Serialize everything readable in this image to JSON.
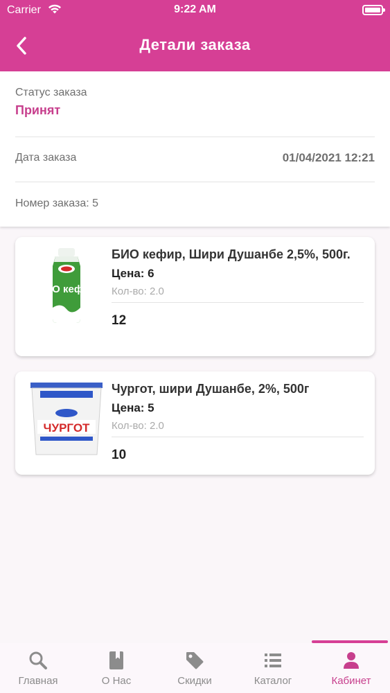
{
  "status_bar": {
    "carrier": "Carrier",
    "time": "9:22 AM"
  },
  "header": {
    "title": "Детали заказа",
    "back_icon": "chevron-left-icon"
  },
  "order": {
    "status_label": "Статус заказа",
    "status_value": "Принят",
    "date_label": "Дата заказа",
    "date_value": "01/04/2021 12:21",
    "number_text": "Номер заказа: 5"
  },
  "items": [
    {
      "name": "БИО кефир, Шири Душанбе 2,5%, 500г.",
      "price": "Цена: 6",
      "qty": "Кол-во: 2.0",
      "total": "12",
      "image_label": "БИО кефир"
    },
    {
      "name": "Чургот, шири Душанбе, 2%, 500г",
      "price": "Цена: 5",
      "qty": "Кол-во: 2.0",
      "total": "10",
      "image_label": "ЧУРГОТ"
    }
  ],
  "tabs": [
    {
      "label": "Главная",
      "icon": "search-icon"
    },
    {
      "label": "О Нас",
      "icon": "book-icon"
    },
    {
      "label": "Скидки",
      "icon": "tag-icon"
    },
    {
      "label": "Каталог",
      "icon": "list-icon"
    },
    {
      "label": "Кабинет",
      "icon": "user-icon",
      "active": true
    }
  ],
  "colors": {
    "accent": "#d63f95",
    "status": "#c73f8d",
    "inactive_tab": "#8c8c8c"
  }
}
